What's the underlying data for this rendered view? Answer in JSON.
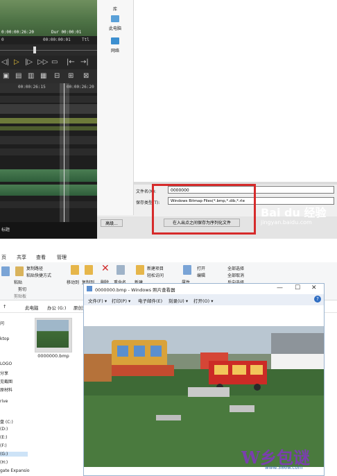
{
  "editor": {
    "timecodes": {
      "left": "0:00:00:26:20",
      "dur": "Dur 00:00:01",
      "ttl": "Ttl"
    },
    "tc_row": [
      "0",
      "00:00:00:01",
      "Ttl"
    ],
    "ruler": "00:00:26:15",
    "ruler_end": "00:00:26:20",
    "transport_icons": [
      "prev-frame-icon",
      "play-icon",
      "next-frame-icon",
      "fast-forward-icon",
      "output-icon",
      "mark-in-icon",
      "mark-out-icon"
    ],
    "bottom_label": "标题"
  },
  "save_dialog": {
    "nav_items": [
      "库",
      "此电脑",
      "网络"
    ],
    "filename_label": "文件名(N):",
    "filename_value": "0000000",
    "filetype_label": "保存类型(T):",
    "filetype_value": "Windows Bitmap Files(*.bmp,*.dib,*.rle",
    "advanced_button": "高级...",
    "sequence_button": "在入出点之间保存为序列化文件",
    "watermark_brand": "Bai du 经验",
    "watermark_url": "jingyan.baidu.com"
  },
  "explorer": {
    "ribbon_tabs": [
      "页",
      "共享",
      "查看",
      "管理"
    ],
    "ribbon_groups": {
      "clipboard": [
        "复制路径",
        "粘贴快捷方式",
        "剪切",
        "粘贴",
        "剪贴板"
      ],
      "organize": [
        "移动到",
        "复制到",
        "删除",
        "重命名"
      ],
      "new": [
        "新建项目",
        "轻松访问",
        "新建"
      ],
      "open": [
        "打开",
        "编辑",
        "属性"
      ],
      "select": [
        "全部选择",
        "全部取消",
        "反向选择"
      ]
    },
    "address": [
      "此电脑",
      "办公 (G:)",
      "原创文"
    ],
    "nav_items": [
      "问",
      "ktop",
      "LOGO",
      "分享",
      "见截图",
      "原材料",
      "rive",
      "盘 (C:)",
      "(D:)",
      "(E:)",
      "(F:)",
      "(G:)",
      "(H:)",
      "gate Expansio"
    ],
    "file_name": "0000000.bmp"
  },
  "photo_viewer": {
    "title": "0000000.bmp - Windows 照片查看器",
    "menu": [
      "文件(F) ▾",
      "打印(P) ▾",
      "电子邮件(E)",
      "刻录(U) ▾",
      "打开(O) ▾"
    ],
    "controls": [
      "—",
      "☐",
      "✕"
    ]
  },
  "watermark2": {
    "logo": "W乡包谜",
    "url": "www.386w.com"
  }
}
